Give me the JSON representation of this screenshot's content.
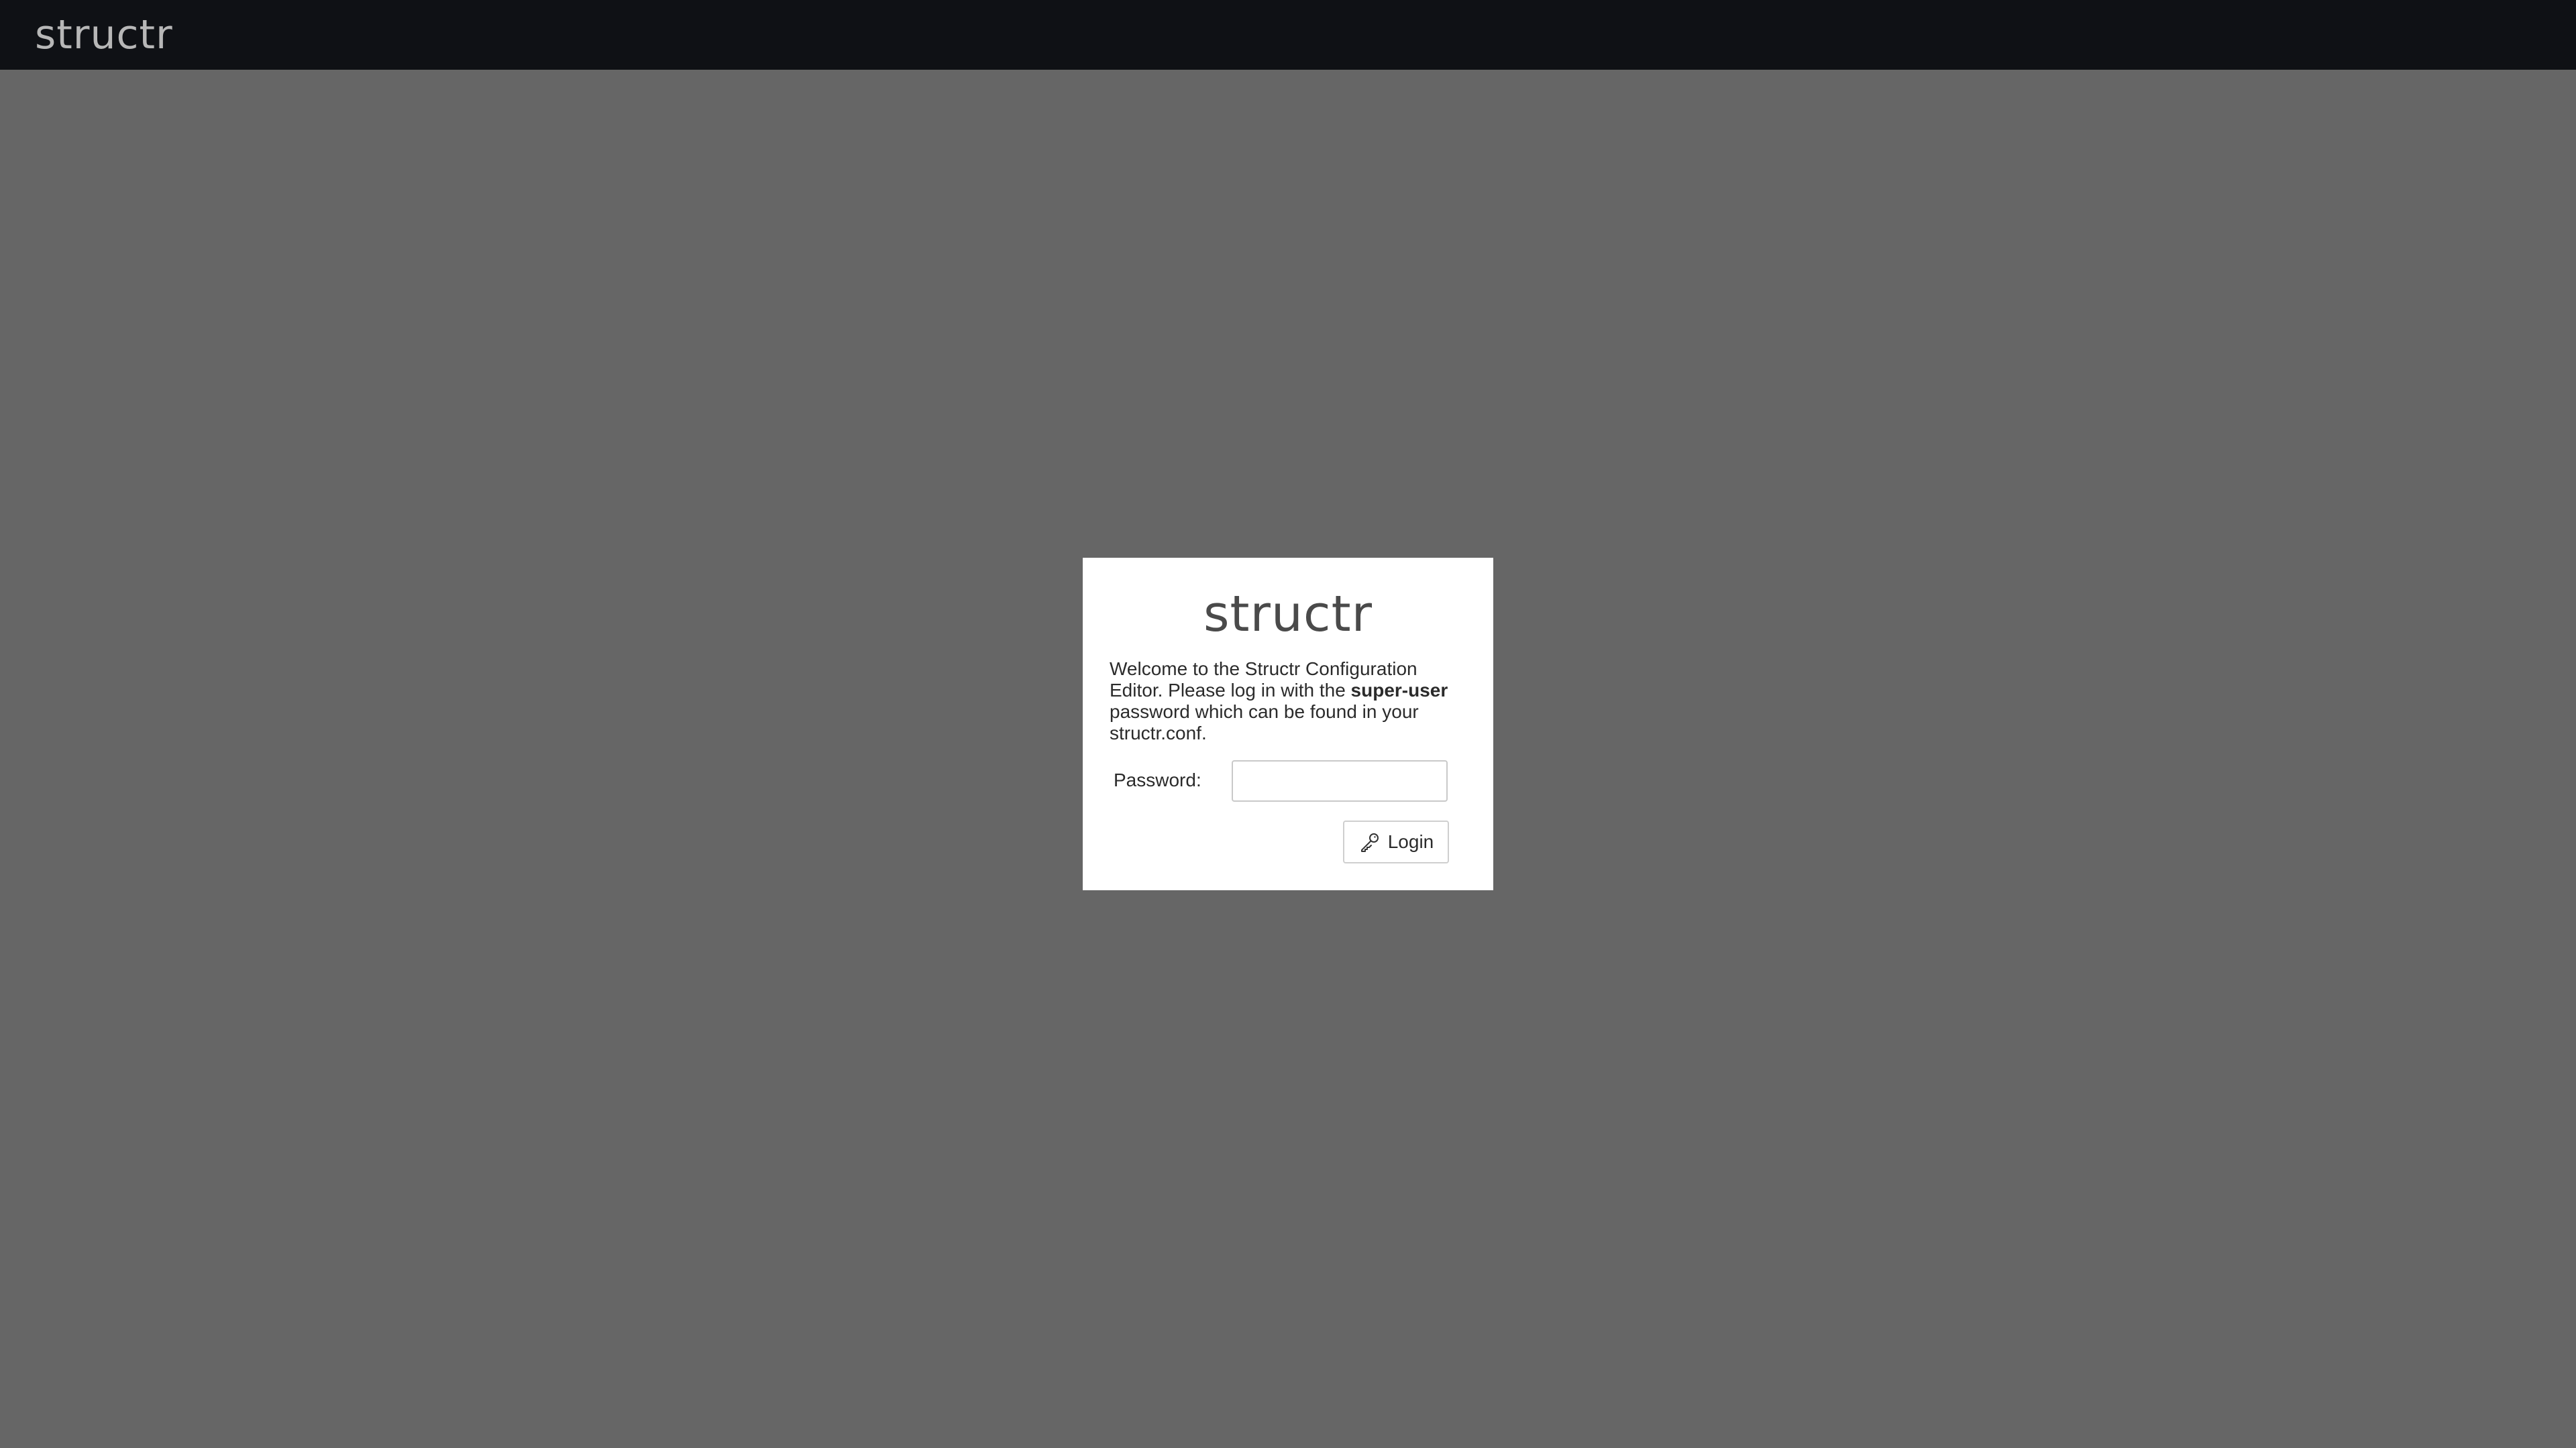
{
  "header": {
    "logo_text": "structr"
  },
  "login": {
    "logo_text": "structr",
    "welcome_pre": "Welcome to the Structr Configuration Editor. Please log in with the ",
    "welcome_bold": "super-user",
    "welcome_post": " password which can be found in your structr.conf.",
    "password_label": "Password:",
    "password_value": "",
    "password_placeholder": "",
    "login_button_label": "Login",
    "login_icon": "login-icon"
  },
  "colors": {
    "background": "#666666",
    "topbar": "#0f1115",
    "box": "#ffffff"
  }
}
